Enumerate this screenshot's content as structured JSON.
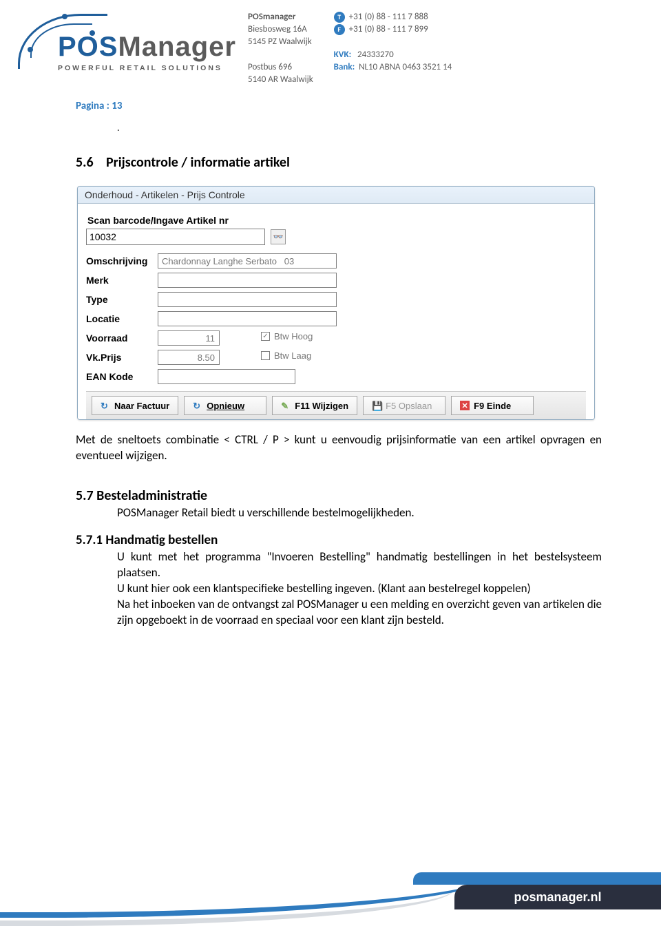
{
  "header": {
    "company_name": "POSManager",
    "tagline": "POWERFUL RETAIL SOLUTIONS",
    "address1_label": "POSmanager",
    "address1_line1": "Biesbosweg 16A",
    "address1_line2": "5145 PZ  Waalwijk",
    "address2_line1": "Postbus 696",
    "address2_line2": "5140 AR  Waalwijk",
    "tel_badge": "T",
    "fax_badge": "F",
    "tel": "+31 (0) 88 - 111 7 888",
    "fax": "+31 (0) 88 - 111 7 899",
    "kvk_label": "KVK:",
    "kvk_value": "24333270",
    "bank_label": "Bank:",
    "bank_value": "NL10 ABNA 0463 3521 14"
  },
  "page_label": "Pagina :  13",
  "dot": ".",
  "section56": {
    "num": "5.6",
    "title": "Prijscontrole / informatie artikel",
    "paragraph": "Met de sneltoets combinatie <  CTRL / P  > kunt u eenvoudig prijsinformatie van een artikel opvragen en eventueel wijzigen."
  },
  "window": {
    "title": "Onderhoud - Artikelen - Prijs Controle",
    "scan_label": "Scan barcode/Ingave Artikel nr",
    "scan_value": "10032",
    "fields": {
      "omschrijving_label": "Omschrijving",
      "omschrijving_value": "Chardonnay Langhe Serbato   03",
      "merk_label": "Merk",
      "merk_value": "",
      "type_label": "Type",
      "type_value": "",
      "locatie_label": "Locatie",
      "locatie_value": "",
      "voorraad_label": "Voorraad",
      "voorraad_value": "11",
      "vkprijs_label": "Vk.Prijs",
      "vkprijs_value": "8.50",
      "btw_hoog_label": "Btw Hoog",
      "btw_hoog_checked": true,
      "btw_laag_label": "Btw Laag",
      "btw_laag_checked": false,
      "ean_label": "EAN Kode",
      "ean_value": ""
    },
    "toolbar": {
      "naar_factuur": "Naar Factuur",
      "opnieuw": "Opnieuw",
      "wijzigen": "F11 Wijzigen",
      "opslaan": "F5 Opslaan",
      "einde": "F9 Einde"
    }
  },
  "section57": {
    "title": "5.7 Besteladministratie",
    "para": "POSManager Retail biedt u verschillende bestelmogelijkheden."
  },
  "section571": {
    "title": "5.7.1 Handmatig bestellen",
    "para1": "U kunt met het programma \"Invoeren Bestelling\" handmatig bestellingen in het bestelsysteem plaatsen.",
    "para2": "U kunt hier ook een klantspecifieke bestelling ingeven. (Klant aan bestelregel koppelen)",
    "para3": "Na het inboeken van de ontvangst zal POSManager u een melding en overzicht geven van artikelen die zijn opgeboekt in de voorraad en speciaal voor een klant zijn besteld."
  },
  "footer_url": "posmanager.nl"
}
